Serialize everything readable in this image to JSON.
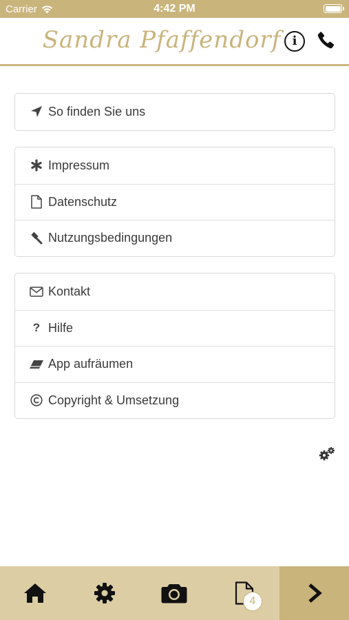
{
  "status_bar": {
    "carrier": "Carrier",
    "time": "4:42 PM"
  },
  "header": {
    "brand": "Sandra Pfaffendorf",
    "info_icon": "info-icon",
    "phone_icon": "phone-icon"
  },
  "groups": [
    {
      "items": [
        {
          "label": "So finden Sie uns",
          "icon": "location-arrow-icon"
        }
      ]
    },
    {
      "items": [
        {
          "label": "Impressum",
          "icon": "asterisk-icon"
        },
        {
          "label": "Datenschutz",
          "icon": "document-icon"
        },
        {
          "label": "Nutzungsbedingungen",
          "icon": "gavel-icon"
        }
      ]
    },
    {
      "items": [
        {
          "label": "Kontakt",
          "icon": "envelope-icon"
        },
        {
          "label": "Hilfe",
          "icon": "question-icon"
        },
        {
          "label": "App aufräumen",
          "icon": "eraser-icon"
        },
        {
          "label": "Copyright & Umsetzung",
          "icon": "copyright-icon"
        }
      ]
    }
  ],
  "settings_icon": "gears-icon",
  "tabbar": {
    "tabs": [
      {
        "name": "home",
        "icon": "home-icon"
      },
      {
        "name": "settings",
        "icon": "gear-icon"
      },
      {
        "name": "camera",
        "icon": "camera-icon"
      },
      {
        "name": "documents",
        "icon": "document-icon",
        "badge": "4"
      },
      {
        "name": "next",
        "icon": "chevron-right-icon"
      }
    ]
  },
  "colors": {
    "accent": "#c9b47c",
    "tabbar_bg": "#dccda4",
    "text": "#3a3a3a"
  }
}
